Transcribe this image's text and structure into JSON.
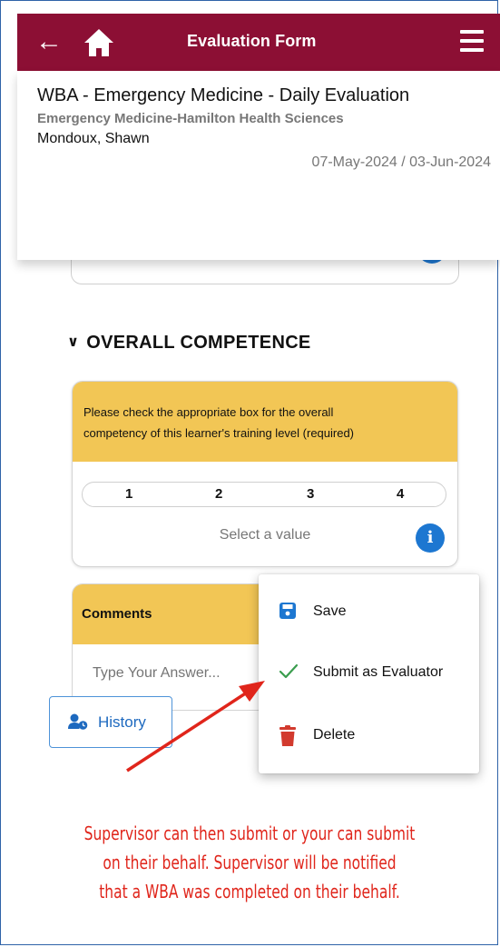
{
  "topbar": {
    "title": "Evaluation Form"
  },
  "header": {
    "title": "WBA - Emergency Medicine - Daily Evaluation",
    "subtitle": "Emergency Medicine-Hamilton Health Sciences",
    "learner": "Mondoux, Shawn",
    "dates": "07-May-2024 / 03-Jun-2024"
  },
  "section": {
    "title": "OVERALL COMPETENCE"
  },
  "competence": {
    "prompt_line1": "Please check the appropriate box for the overall",
    "prompt_line2": "competency of this learner's training level  (required)",
    "options": [
      "1",
      "2",
      "3",
      "4"
    ],
    "hint": "Select a value"
  },
  "comments": {
    "label": "Comments",
    "placeholder": "Type Your Answer..."
  },
  "history": {
    "label": "History"
  },
  "menu": {
    "save": "Save",
    "submit": "Submit as Evaluator",
    "delete": "Delete"
  },
  "note": {
    "line1": "Supervisor can then submit or your can submit",
    "line2": "on their behalf. Supervisor will be notified",
    "line3": "that a WBA was completed on their behalf."
  },
  "colors": {
    "brand": "#8c0f34",
    "yellow": "#f2c655",
    "info_blue": "#1d77d1",
    "note_red": "#e0251b",
    "check_green": "#3a9d4e",
    "delete_red": "#d23a2e",
    "save_blue": "#1d77d1"
  }
}
